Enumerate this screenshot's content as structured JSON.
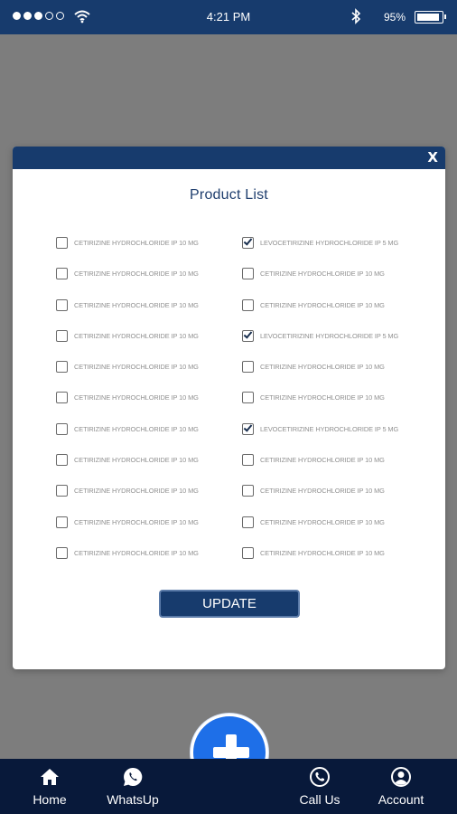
{
  "status_bar": {
    "time": "4:21 PM",
    "battery": "95%",
    "battery_level": 0.95,
    "signal_bars_filled": 3,
    "signal_bars_total": 5,
    "icons": [
      "signal-icon",
      "wifi-icon",
      "bluetooth-icon",
      "battery-icon"
    ]
  },
  "modal": {
    "close_label": "X",
    "title": "Product List",
    "update_label": "UPDATE",
    "products": [
      {
        "label": "CETIRIZINE HYDROCHLORIDE IP 10 MG",
        "checked": false
      },
      {
        "label": "LEVOCETIRIZINE HYDROCHLORIDE IP 5 MG",
        "checked": true
      },
      {
        "label": "CETIRIZINE HYDROCHLORIDE IP 10 MG",
        "checked": false
      },
      {
        "label": "CETIRIZINE HYDROCHLORIDE IP 10 MG",
        "checked": false
      },
      {
        "label": "CETIRIZINE HYDROCHLORIDE IP 10 MG",
        "checked": false
      },
      {
        "label": "CETIRIZINE HYDROCHLORIDE IP 10 MG",
        "checked": false
      },
      {
        "label": "CETIRIZINE HYDROCHLORIDE IP 10 MG",
        "checked": false
      },
      {
        "label": "LEVOCETIRIZINE HYDROCHLORIDE IP 5 MG",
        "checked": true
      },
      {
        "label": "CETIRIZINE HYDROCHLORIDE IP 10 MG",
        "checked": false
      },
      {
        "label": "CETIRIZINE HYDROCHLORIDE IP 10 MG",
        "checked": false
      },
      {
        "label": "CETIRIZINE HYDROCHLORIDE IP 10 MG",
        "checked": false
      },
      {
        "label": "CETIRIZINE HYDROCHLORIDE IP 10 MG",
        "checked": false
      },
      {
        "label": "CETIRIZINE HYDROCHLORIDE IP 10 MG",
        "checked": false
      },
      {
        "label": "LEVOCETIRIZINE HYDROCHLORIDE IP 5 MG",
        "checked": true
      },
      {
        "label": "CETIRIZINE HYDROCHLORIDE IP 10 MG",
        "checked": false
      },
      {
        "label": "CETIRIZINE HYDROCHLORIDE IP 10 MG",
        "checked": false
      },
      {
        "label": "CETIRIZINE HYDROCHLORIDE IP 10 MG",
        "checked": false
      },
      {
        "label": "CETIRIZINE HYDROCHLORIDE IP 10 MG",
        "checked": false
      },
      {
        "label": "CETIRIZINE HYDROCHLORIDE IP 10 MG",
        "checked": false
      },
      {
        "label": "CETIRIZINE HYDROCHLORIDE IP 10 MG",
        "checked": false
      },
      {
        "label": "CETIRIZINE HYDROCHLORIDE IP 10 MG",
        "checked": false
      },
      {
        "label": "CETIRIZINE HYDROCHLORIDE IP 10 MG",
        "checked": false
      }
    ]
  },
  "bottom_nav": {
    "items": [
      {
        "label": "Home",
        "icon": "home-icon"
      },
      {
        "label": "WhatsUp",
        "icon": "whatsapp-icon"
      },
      {
        "label": "Call Us",
        "icon": "phone-icon"
      },
      {
        "label": "Account",
        "icon": "account-icon"
      }
    ],
    "fab_icon": "plus-icon"
  },
  "colors": {
    "header_bg": "#173b6d",
    "nav_bg": "#08193a",
    "fab_bg": "#1e6fe8",
    "overlay": "#7d7d7d",
    "title": "#1f3e6e",
    "label": "#909090"
  }
}
